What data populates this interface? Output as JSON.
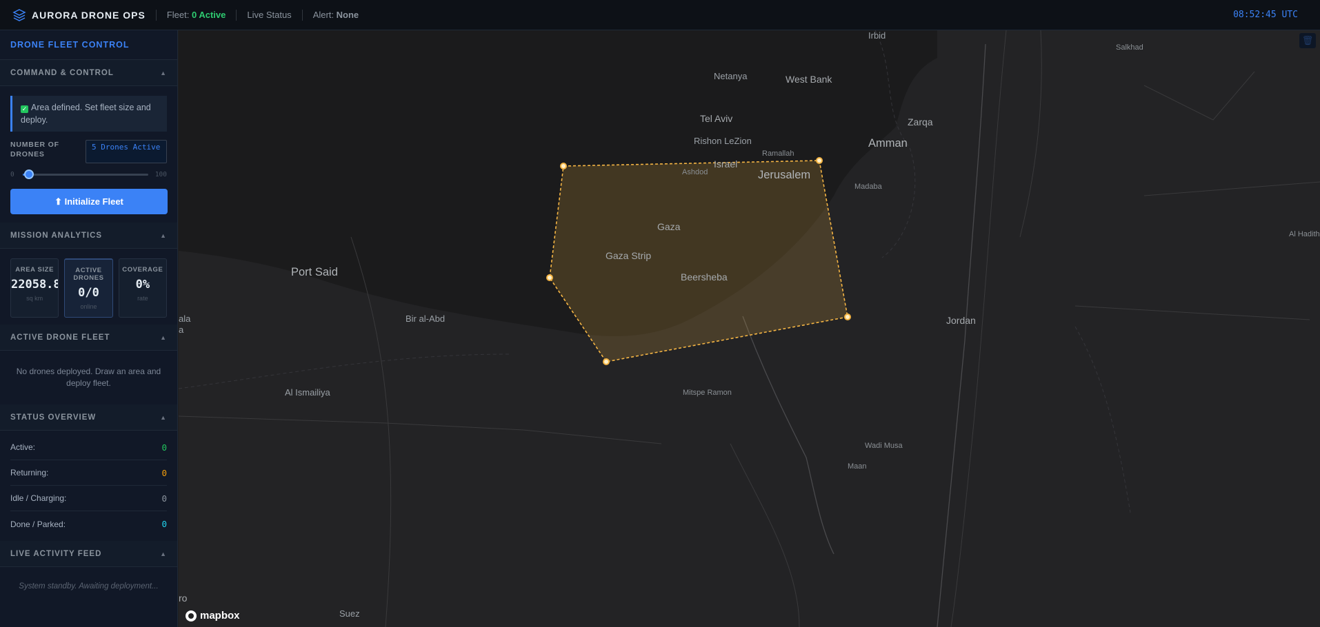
{
  "topbar": {
    "brand": "AURORA DRONE OPS",
    "fleet_label": "Fleet:",
    "fleet_value": "0 Active",
    "live_status": "Live Status",
    "alert_label": "Alert:",
    "alert_value": "None",
    "clock": "08:52:45 UTC"
  },
  "sidebar": {
    "header": "DRONE FLEET CONTROL",
    "command": {
      "title": "COMMAND & CONTROL",
      "notice": "Area defined. Set fleet size and deploy.",
      "drones_label": "NUMBER OF DRONES",
      "drones_value": "5 Drones Active",
      "slider_min": "0",
      "slider_max": "100",
      "slider_value": 5,
      "init_button": "⬆ Initialize Fleet"
    },
    "analytics": {
      "title": "MISSION ANALYTICS",
      "stats": [
        {
          "label": "AREA SIZE",
          "value": "22058.8",
          "sub": "sq km"
        },
        {
          "label": "ACTIVE DRONES",
          "value": "0/0",
          "sub": "online"
        },
        {
          "label": "COVERAGE",
          "value": "0%",
          "sub": "rate"
        }
      ]
    },
    "fleet": {
      "title": "ACTIVE DRONE FLEET",
      "empty": "No drones deployed. Draw an area and deploy fleet."
    },
    "status": {
      "title": "STATUS OVERVIEW",
      "rows": [
        {
          "label": "Active:",
          "value": "0",
          "color": "#22c55e"
        },
        {
          "label": "Returning:",
          "value": "0",
          "color": "#f59e0b"
        },
        {
          "label": "Idle / Charging:",
          "value": "0",
          "color": "#8b949e"
        },
        {
          "label": "Done / Parked:",
          "value": "0",
          "color": "#22d3ee"
        }
      ]
    },
    "feed": {
      "title": "LIVE ACTIVITY FEED",
      "text": "System standby. Awaiting deployment..."
    }
  },
  "map": {
    "attribution": "mapbox",
    "places": {
      "irbid": "Irbid",
      "salkhad": "Salkhad",
      "netanya": "Netanya",
      "west_bank": "West Bank",
      "tel_aviv": "Tel Aviv",
      "zarqa": "Zarqa",
      "rishon": "Rishon LeZion",
      "amman": "Amman",
      "ramallah": "Ramallah",
      "israel": "Israel",
      "ashdod": "Ashdod",
      "jerusalem": "Jerusalem",
      "madaba": "Madaba",
      "gaza": "Gaza",
      "al_hadith": "Al Hadith",
      "port_said": "Port Said",
      "gaza_strip": "Gaza Strip",
      "beersheba": "Beersheba",
      "bir_al_abd": "Bir al-Abd",
      "jordan": "Jordan",
      "ala": "ala",
      "a": "a",
      "al_ismailiya": "Al Ismailiya",
      "mitspe_ramon": "Mitspe Ramon",
      "wadi_musa": "Wadi Musa",
      "maan": "Maan",
      "ro": "ro",
      "suez": "Suez"
    },
    "polygon_color": "#f5b544"
  }
}
